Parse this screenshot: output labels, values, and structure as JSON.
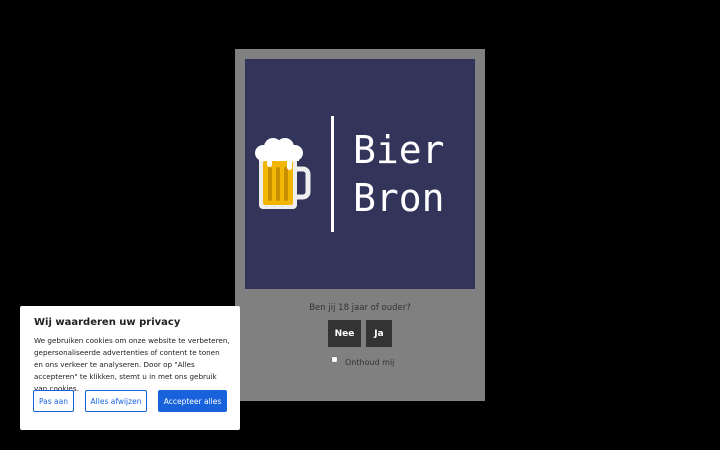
{
  "age_gate": {
    "logo": {
      "line1": "Bier",
      "line2": "Bron",
      "icon": "beer-mug-icon"
    },
    "question": "Ben jij 18 jaar of ouder?",
    "no_label": "Nee",
    "yes_label": "Ja",
    "remember_label": "Onthoud mij",
    "remember_checked": false
  },
  "cookie_banner": {
    "title": "Wij waarderen uw privacy",
    "text": "We gebruiken cookies om onze website te verbeteren, gepersonaliseerde advertenties of content te tonen en ons verkeer te analyseren. Door op \"Alles accepteren\" te klikken, stemt u in met ons gebruik van cookies.",
    "customize_label": "Pas aan",
    "reject_label": "Alles afwijzen",
    "accept_label": "Accepteer alles"
  },
  "colors": {
    "backdrop": "#000000",
    "modal_bg": "#808080",
    "logo_bg": "#333459",
    "button_dark": "#333333",
    "accent_blue": "#1863dc"
  }
}
